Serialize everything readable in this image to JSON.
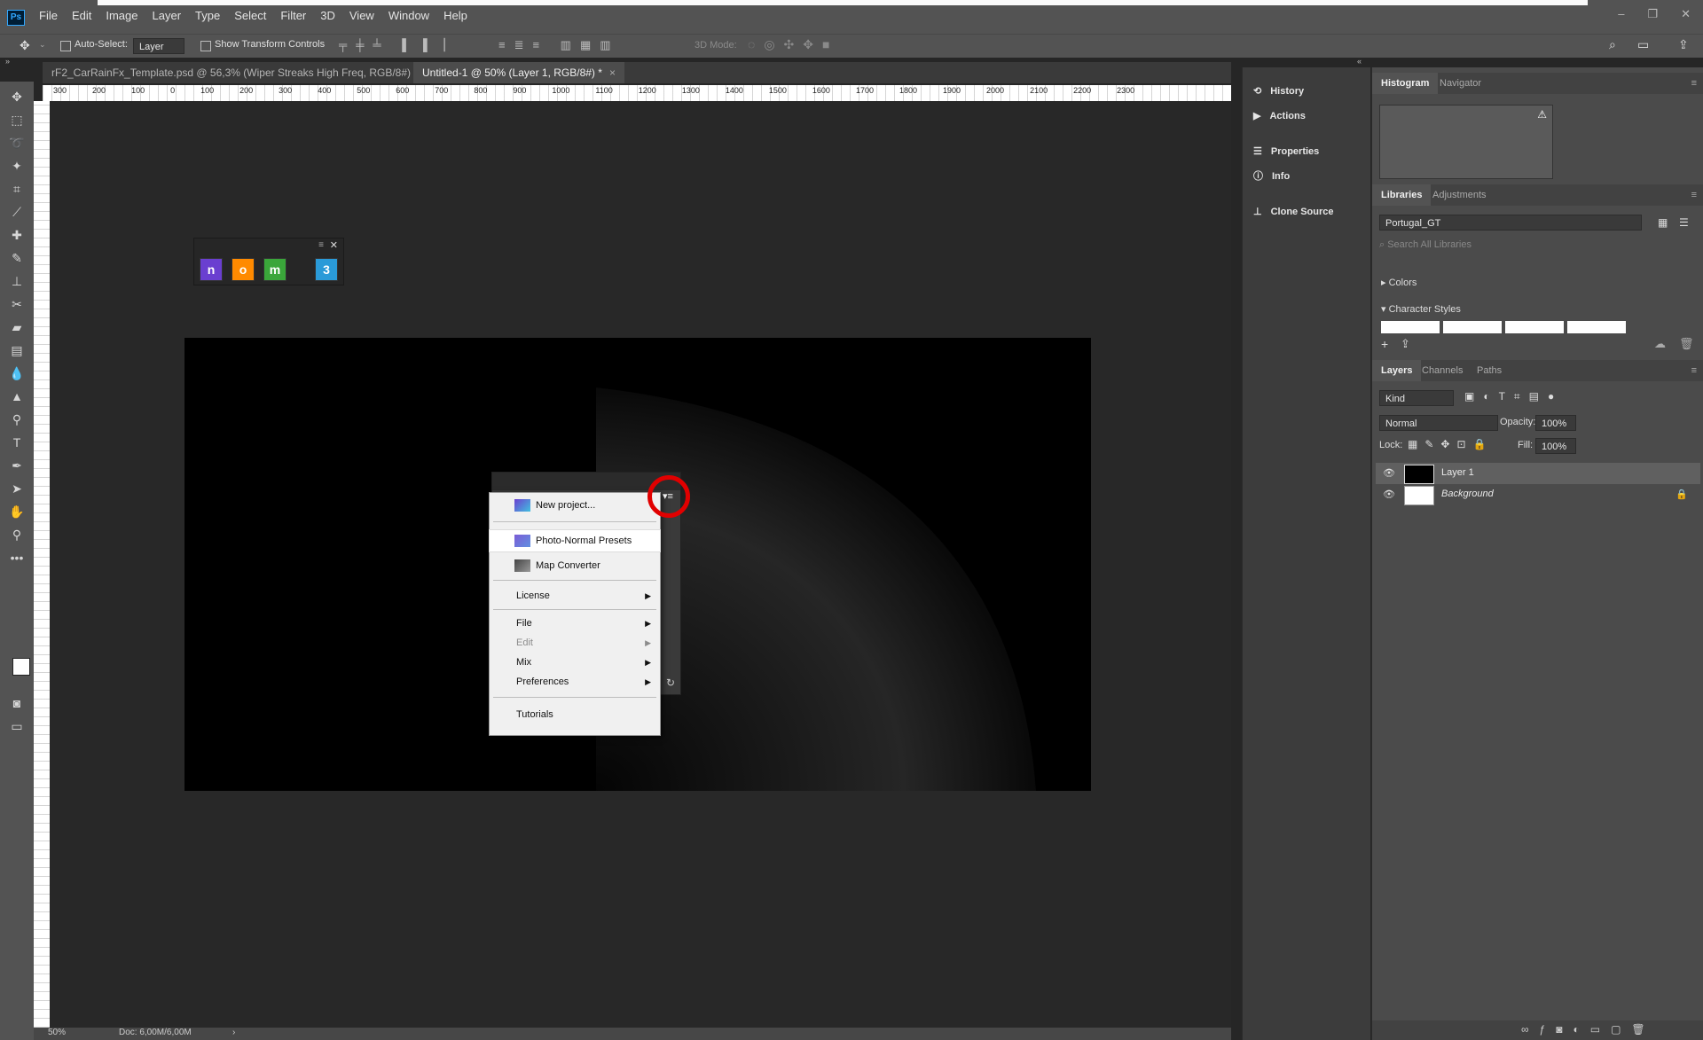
{
  "app": {
    "logo": "Ps"
  },
  "menu": [
    "File",
    "Edit",
    "Image",
    "Layer",
    "Type",
    "Select",
    "Filter",
    "3D",
    "View",
    "Window",
    "Help"
  ],
  "window_controls": [
    "–",
    "❐",
    "✕"
  ],
  "options_bar": {
    "auto_select_label": "Auto-Select:",
    "auto_select_value": "Layer",
    "show_transform_label": "Show Transform Controls",
    "mode_3d_label": "3D Mode:"
  },
  "tabs": [
    {
      "label": "rF2_CarRainFx_Template.psd @ 56,3% (Wiper Streaks High Freq, RGB/8#) *",
      "close": "×"
    },
    {
      "label": "Untitled-1 @ 50% (Layer 1, RGB/8#) *",
      "close": "×"
    }
  ],
  "ruler_ticks": [
    "300",
    "200",
    "100",
    "0",
    "100",
    "200",
    "300",
    "400",
    "500",
    "600",
    "700",
    "800",
    "900",
    "1000",
    "1100",
    "1200",
    "1300",
    "1400",
    "1500",
    "1600",
    "1700",
    "1800",
    "1900",
    "2000",
    "2100",
    "2200",
    "2300"
  ],
  "status": {
    "zoom": "50%",
    "doc": "Doc: 6,00M/6,00M",
    "arrow": "›"
  },
  "float_panel": {
    "buttons": [
      "n",
      "o",
      "m",
      "3"
    ],
    "colors": [
      "#6a3fd0",
      "#ff8a00",
      "#3aa63a",
      "#2a9ad8"
    ]
  },
  "context_menu": {
    "items": [
      {
        "label": "New project...",
        "type": "icon"
      },
      {
        "label": "Photo-Normal Presets",
        "type": "icon"
      },
      {
        "label": "Map Converter",
        "type": "icon"
      },
      {
        "label": "License",
        "type": "sub"
      },
      {
        "label": "File",
        "type": "sub"
      },
      {
        "label": "Edit",
        "type": "sub-disabled"
      },
      {
        "label": "Mix",
        "type": "sub"
      },
      {
        "label": "Preferences",
        "type": "sub"
      },
      {
        "label": "Tutorials",
        "type": "plain"
      }
    ]
  },
  "panel_col1": [
    "History",
    "Actions",
    "Properties",
    "Info",
    "Clone Source"
  ],
  "histogram": {
    "tabs": [
      "Histogram",
      "Navigator"
    ]
  },
  "libraries": {
    "tabs": [
      "Libraries",
      "Adjustments"
    ],
    "library_name": "Portugal_GT",
    "search_placeholder": "Search All Libraries",
    "sections": [
      "Colors",
      "Character Styles"
    ]
  },
  "layers": {
    "tabs": [
      "Layers",
      "Channels",
      "Paths"
    ],
    "kind": "Kind",
    "blend_mode": "Normal",
    "opacity_label": "Opacity:",
    "opacity_value": "100%",
    "lock_label": "Lock:",
    "fill_label": "Fill:",
    "fill_value": "100%",
    "rows": [
      {
        "name": "Layer 1"
      },
      {
        "name": "Background"
      }
    ]
  }
}
